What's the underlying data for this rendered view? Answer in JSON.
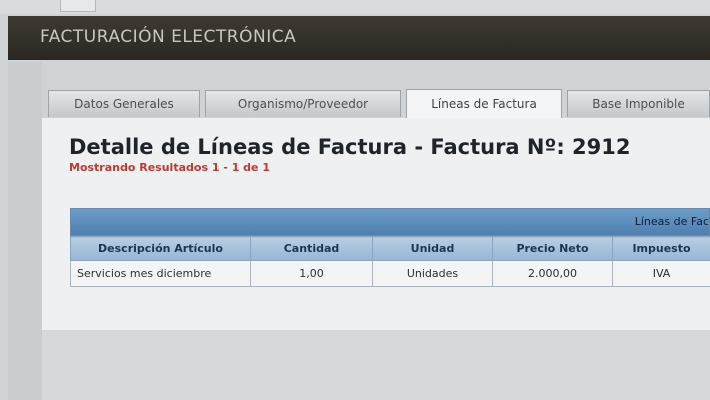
{
  "app": {
    "header_title": "FACTURACIÓN ELECTRÓNICA"
  },
  "tabs": [
    {
      "label": "Datos Generales",
      "active": false
    },
    {
      "label": "Organismo/Proveedor",
      "active": false
    },
    {
      "label": "Líneas de Factura",
      "active": true
    },
    {
      "label": "Base Imponible",
      "active": false
    }
  ],
  "main": {
    "title": "Detalle de Líneas de Factura - Factura Nº: 2912",
    "results_text": "Mostrando Resultados 1 - 1 de 1",
    "grid_caption": "Líneas de Fac",
    "columns": [
      "Descripción Artículo",
      "Cantidad",
      "Unidad",
      "Precio Neto",
      "Impuesto"
    ],
    "rows": [
      [
        "Servicios mes diciembre",
        "1,00",
        "Unidades",
        "2.000,00",
        "IVA"
      ]
    ]
  },
  "colors": {
    "header_bg": "#2f2c27",
    "grid_header": "#5a8abb",
    "results_text": "#c23a32"
  }
}
